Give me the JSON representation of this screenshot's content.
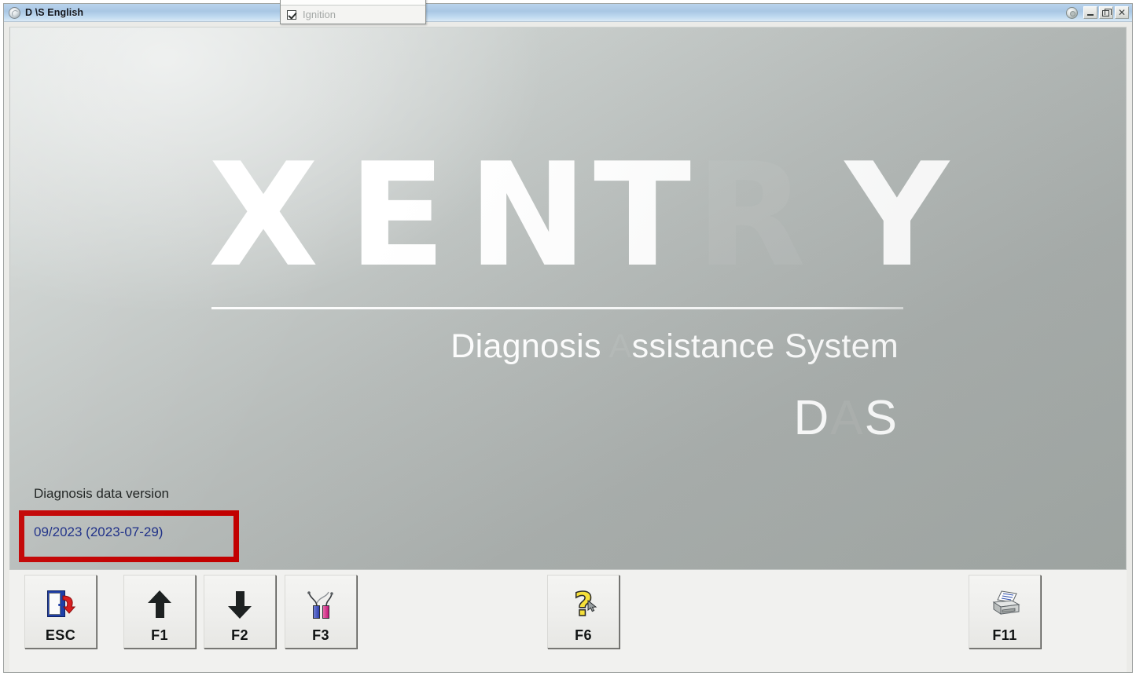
{
  "window": {
    "title": "D \\S English",
    "app_icon": "globe-icon",
    "gear_icon": "gear-icon",
    "controls": {
      "minimize": "_",
      "restore": "❐",
      "close": "×"
    }
  },
  "dropdown": {
    "partial_item_label": "",
    "items": [
      {
        "label": "Ignition",
        "checked": true
      }
    ]
  },
  "splash": {
    "wordmark": {
      "letters": [
        "X",
        "E",
        "N",
        "T",
        "R",
        "Y"
      ],
      "faded_letter_index": 4
    },
    "subtitle_prefix": "Diagnosis ",
    "subtitle_faded": "A",
    "subtitle_suffix": "ssistance System",
    "acronym_prefix": "D",
    "acronym_faded": "A",
    "acronym_suffix": "S",
    "version_label": "Diagnosis data version",
    "version_value": "09/2023 (2023-07-29)",
    "highlight_color": "#c20000",
    "version_text_color": "#1b2d86"
  },
  "function_bar": {
    "buttons": [
      {
        "key": "ESC",
        "icon": "exit-door-icon"
      },
      {
        "key": "F1",
        "icon": "arrow-up-icon"
      },
      {
        "key": "F2",
        "icon": "arrow-down-icon"
      },
      {
        "key": "F3",
        "icon": "test-probes-icon"
      },
      {
        "key": "F6",
        "icon": "help-question-icon"
      },
      {
        "key": "F11",
        "icon": "printer-icon"
      }
    ]
  }
}
